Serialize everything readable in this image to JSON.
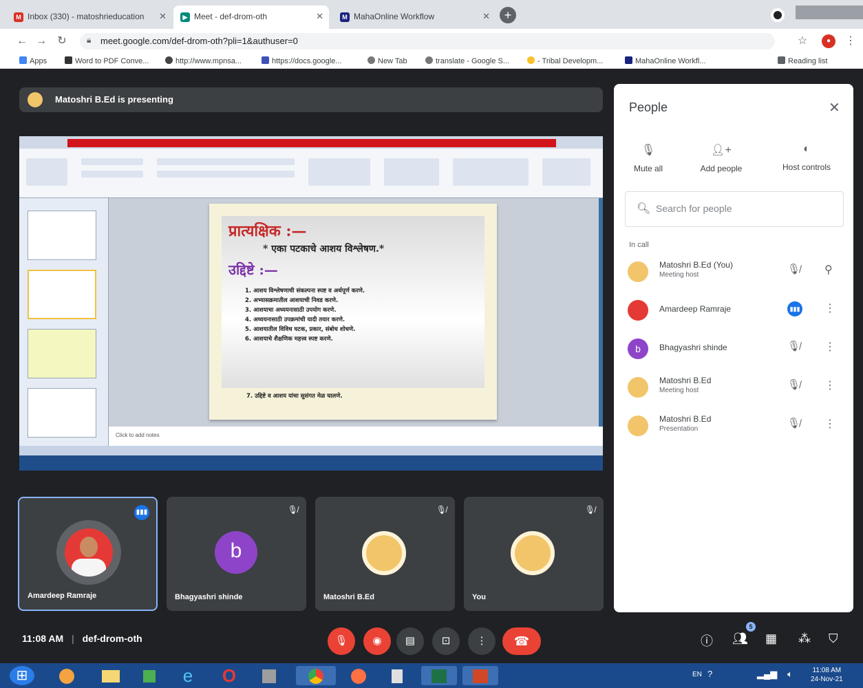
{
  "browser": {
    "tabs": [
      {
        "title": "Inbox (330) - matoshrieducation",
        "favicon_color": "#d93025"
      },
      {
        "title": "Meet - def-drom-oth",
        "favicon_color": "#00897b"
      },
      {
        "title": "MahaOnline Workflow",
        "favicon_color": "#1a237e"
      }
    ],
    "new_tab_label": "+",
    "url": "meet.google.com/def-drom-oth?pli=1&authuser=0",
    "bookmarks": [
      {
        "label": "Apps"
      },
      {
        "label": "Word to PDF Conve..."
      },
      {
        "label": "http://www.mpnsa..."
      },
      {
        "label": "https://docs.google..."
      },
      {
        "label": "New Tab"
      },
      {
        "label": "translate - Google S..."
      },
      {
        "label": "- Tribal Developm..."
      },
      {
        "label": "MahaOnline Workfl..."
      }
    ],
    "reading_list_label": "Reading list"
  },
  "meet": {
    "presenting_text": "Matoshri B.Ed is presenting",
    "slide": {
      "heading": "प्रात्यक्षिक :—",
      "subheading": "* एका पटकाचे आशय विश्लेषण.*",
      "objectives_title": "उद्दिष्टे :—",
      "points": [
        "1. आशय विश्लेषणाची संकल्पना स्पष्ट व अर्थपूर्ण करणे.",
        "2. अभ्यासक्रमातील आशयाची निवड करणे.",
        "3. आशयाचा अध्ययनासाठी उपयोग करणे.",
        "4. अध्ययनासाठी उपक्रमांची यादी तयार करणे.",
        "5. आशयातील विविध घटक, प्रकार, संबोध शोधणे.",
        "6. आशयाचे शैक्षणिक महत्त्व स्पष्ट करणे.",
        "7. उद्दिष्टे व आशय यांचा सुसंगत मेळ घालणे."
      ],
      "notes_placeholder": "Click to add notes"
    },
    "tiles": [
      {
        "name": "Amardeep Ramraje",
        "avatar": "photo",
        "speaking": true
      },
      {
        "name": "Bhagyashri shinde",
        "avatar": "b",
        "speaking": false
      },
      {
        "name": "Matoshri B.Ed",
        "avatar": "logo",
        "speaking": false
      },
      {
        "name": "You",
        "avatar": "logo",
        "speaking": false
      }
    ],
    "bottom": {
      "time": "11:08 AM",
      "separator": "|",
      "meeting_code": "def-drom-oth",
      "people_count": "5"
    }
  },
  "people_panel": {
    "title": "People",
    "actions": [
      {
        "label": "Mute all",
        "icon": "mic-off-icon"
      },
      {
        "label": "Add people",
        "icon": "person-add-icon"
      },
      {
        "label": "Host controls",
        "icon": "toggle-icon"
      }
    ],
    "search_placeholder": "Search for people",
    "section_label": "In call",
    "participants": [
      {
        "name": "Matoshri B.Ed (You)",
        "sub": "Meeting host",
        "avatar_color": "#f2c56b",
        "mic": "muted",
        "extra": "pin"
      },
      {
        "name": "Amardeep Ramraje",
        "sub": "",
        "avatar_color": "#e53935",
        "mic": "speaking",
        "extra": "more"
      },
      {
        "name": "Bhagyashri shinde",
        "sub": "",
        "avatar_color": "#8e44c9",
        "letter": "b",
        "mic": "muted",
        "extra": "more"
      },
      {
        "name": "Matoshri B.Ed",
        "sub": "Meeting host",
        "avatar_color": "#f2c56b",
        "mic": "muted",
        "extra": "more"
      },
      {
        "name": "Matoshri B.Ed",
        "sub": "Presentation",
        "avatar_color": "#f2c56b",
        "mic": "muted",
        "extra": "more"
      }
    ]
  },
  "taskbar": {
    "clock_time": "11:08 AM",
    "clock_date": "24-Nov-21",
    "lang": "EN"
  }
}
